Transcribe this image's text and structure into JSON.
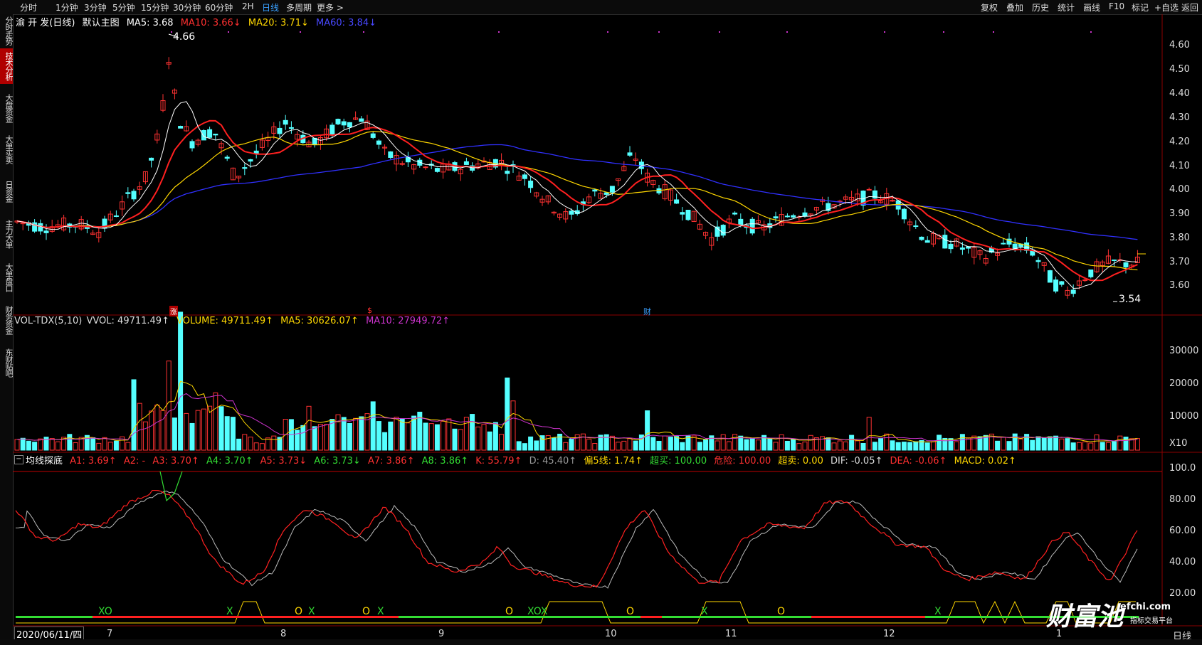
{
  "topbar": {
    "timeframes": [
      "分时",
      "1分钟",
      "3分钟",
      "5分钟",
      "15分钟",
      "30分钟",
      "60分钟",
      "2H",
      "日线",
      "多周期",
      "更多 >"
    ],
    "active": "日线",
    "right_items": [
      "复权",
      "叠加",
      "历史",
      "统计",
      "画线",
      "F10",
      "标记",
      "+自选",
      "返回"
    ]
  },
  "left_tabs": [
    "分时走势",
    "技术分析",
    "大盘资金",
    "大单买卖",
    "日资金",
    "主力大单",
    "大单盘口",
    "财务资金",
    "东财贴吧"
  ],
  "main": {
    "stock_name": "渝 开 发(日线)",
    "indicator": "默认主图",
    "ma5": "MA5: 3.68",
    "ma10": "MA10: 3.66↓",
    "ma20": "MA20: 3.71↓",
    "ma60": "MA60: 3.84↓",
    "high_label": "4.66",
    "low_label": "3.54",
    "price_ticks": [
      "4.60",
      "4.50",
      "4.40",
      "4.30",
      "4.20",
      "4.10",
      "4.00",
      "3.90",
      "3.80",
      "3.70",
      "3.60"
    ],
    "markers": [
      "涨",
      "$",
      "财"
    ]
  },
  "volume": {
    "name": "VOL-TDX(5,10)",
    "vvol": "VVOL: 49711.49↑",
    "volume": "VOLUME: 49711.49↑",
    "ma5": "MA5: 30626.07↑",
    "ma10": "MA10: 27949.72↑",
    "ticks": [
      "30000",
      "20000",
      "10000"
    ],
    "unit": "X10"
  },
  "osc": {
    "name": "均线探底",
    "items": [
      {
        "t": "A1: 3.69↑",
        "c": "#ff3030"
      },
      {
        "t": "A2: -",
        "c": "#ff3030"
      },
      {
        "t": "A3: 3.70↑",
        "c": "#ff3030"
      },
      {
        "t": "A4: 3.70↑",
        "c": "#33dd33"
      },
      {
        "t": "A5: 3.73↓",
        "c": "#ff3030"
      },
      {
        "t": "A6: 3.73↓",
        "c": "#33dd33"
      },
      {
        "t": "A7: 3.86↑",
        "c": "#ff3030"
      },
      {
        "t": "A8: 3.86↑",
        "c": "#33dd33"
      },
      {
        "t": "K: 55.79↑",
        "c": "#ff3030"
      },
      {
        "t": "D: 45.40↑",
        "c": "#999999"
      },
      {
        "t": "偏5线: 1.74↑",
        "c": "#ffd700"
      },
      {
        "t": "超买: 100.00",
        "c": "#33dd33"
      },
      {
        "t": "危险: 100.00",
        "c": "#ff3030"
      },
      {
        "t": "超卖: 0.00",
        "c": "#ffd700"
      },
      {
        "t": "DIF: -0.05↑",
        "c": "#dddddd"
      },
      {
        "t": "DEA: -0.06↑",
        "c": "#ff3030"
      },
      {
        "t": "MACD: 0.02↑",
        "c": "#ffd700"
      }
    ],
    "ticks": [
      "100.0",
      "80.00",
      "60.00",
      "40.00",
      "20.00"
    ],
    "signals": [
      "XO",
      "X",
      "O",
      "X",
      "O",
      "X",
      "O",
      "XOX",
      "O",
      "X",
      "O",
      "X"
    ]
  },
  "xaxis": {
    "date": "2020/06/11/四",
    "months": [
      "7",
      "8",
      "9",
      "10",
      "11",
      "12",
      "1"
    ],
    "right_label": "日线"
  },
  "watermark": {
    "text": "财富池",
    "site": "efchi.com",
    "slogan": "指标交易平台"
  },
  "colors": {
    "up": "#ff3232",
    "down": "#54ffff",
    "ma5": "#ffffff",
    "ma10": "#ff2020",
    "ma20": "#ffd700",
    "ma60": "#3030ff",
    "vma10": "#cc33cc"
  }
}
